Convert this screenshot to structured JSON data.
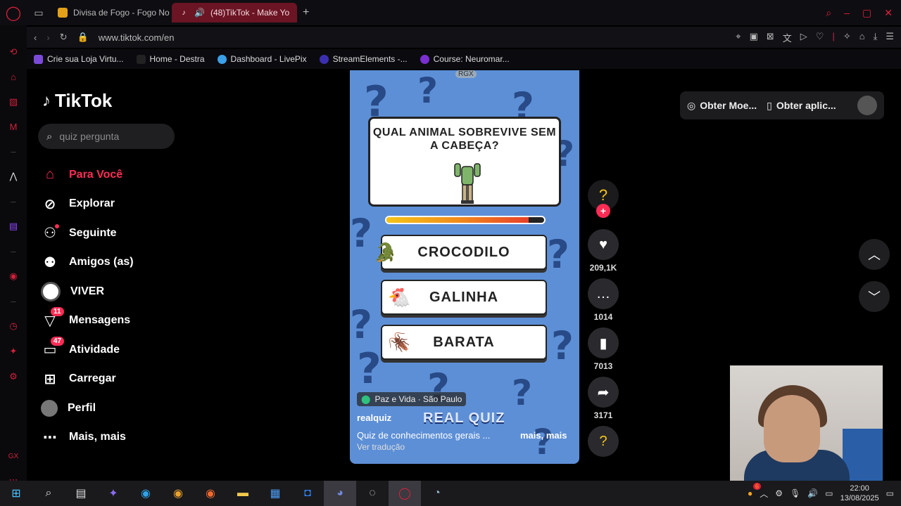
{
  "browser": {
    "tabs": [
      {
        "title": "Divisa de Fogo - Fogo No",
        "favicon_color": "#e3a11a"
      },
      {
        "title": "(48)TikTok - Make Yo",
        "favicon_color": "#ffffff"
      }
    ],
    "url": "www.tiktok.com/en",
    "bookmarks": [
      {
        "label": "Crie sua Loja Virtu...",
        "color": "#7b4ad9"
      },
      {
        "label": "Home - Destra",
        "color": "#222222"
      },
      {
        "label": "Dashboard - LivePix",
        "color": "#3aa0e8"
      },
      {
        "label": "StreamElements -...",
        "color": "#3b2fb0"
      },
      {
        "label": "Course: Neuromar...",
        "color": "#7a2fd0"
      }
    ]
  },
  "tiktok": {
    "logo": "TikTok",
    "search_placeholder": "quiz pergunta",
    "nav": [
      {
        "label": "Para Você",
        "icon": "home-icon",
        "active": true
      },
      {
        "label": "Explorar",
        "icon": "compass-icon"
      },
      {
        "label": "Seguinte",
        "icon": "following-icon"
      },
      {
        "label": "Amigos (as)",
        "icon": "friends-icon"
      },
      {
        "label": "VIVER",
        "icon": "live-icon"
      },
      {
        "label": "Mensagens",
        "icon": "messages-icon",
        "badge": "11"
      },
      {
        "label": "Atividade",
        "icon": "activity-icon",
        "badge": "47"
      },
      {
        "label": "Carregar",
        "icon": "upload-icon"
      },
      {
        "label": "Perfil",
        "icon": "profile-avatar"
      },
      {
        "label": "Mais, mais",
        "icon": "more-icon"
      }
    ],
    "top_buttons": {
      "coins": "Obter Moe...",
      "app": "Obter aplic..."
    },
    "video": {
      "watermark": "RGX",
      "question": "QUAL ANIMAL SOBREVIVE SEM A CABEÇA?",
      "timer_fraction": 0.9,
      "answers": [
        {
          "label": "CROCODILO",
          "icon": "crocodile-icon"
        },
        {
          "label": "GALINHA",
          "icon": "chicken-icon"
        },
        {
          "label": "BARATA",
          "icon": "cockroach-icon"
        }
      ],
      "location": "Paz e Vida · São Paulo",
      "author": "realquiz",
      "brand": "REAL QUIZ",
      "description": "Quiz de conhecimentos gerais ...",
      "more": "mais, mais",
      "translate": "Ver tradução"
    },
    "actions": {
      "likes": "209,1K",
      "comments": "1014",
      "saves": "7013",
      "shares": "3171"
    }
  },
  "taskbar": {
    "time": "22:00",
    "date": "13/08/2025",
    "notification_count": "6"
  },
  "colors": {
    "accent": "#fe2c55",
    "video_bg": "#5d8fd6",
    "opera_red": "#e0203a"
  }
}
